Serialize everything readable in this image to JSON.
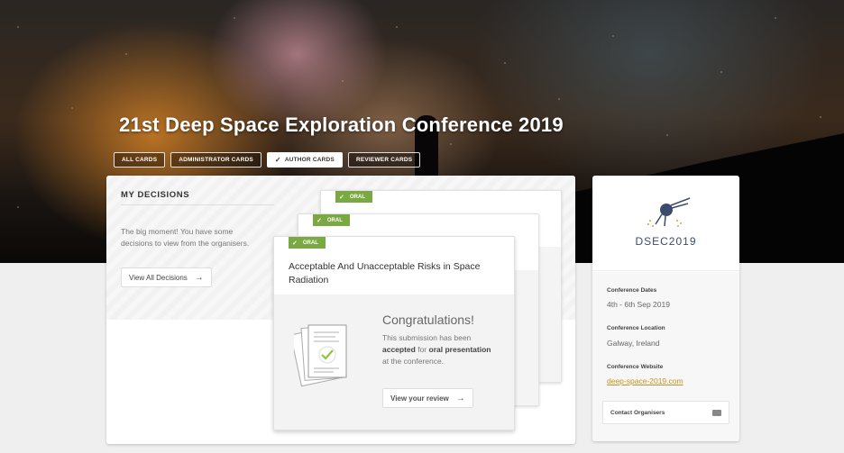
{
  "conference": {
    "title": "21st Deep Space Exploration Conference 2019"
  },
  "tabs": [
    {
      "label": "ALL CARDS",
      "active": false
    },
    {
      "label": "ADMINISTRATOR CARDS",
      "active": false
    },
    {
      "label": "AUTHOR CARDS",
      "active": true
    },
    {
      "label": "REVIEWER CARDS",
      "active": false
    }
  ],
  "decisions": {
    "heading": "MY DECISIONS",
    "intro": "The big moment! You have some decisions to view from the organisers.",
    "view_all_label": "View All Decisions",
    "cards": [
      {
        "badge": "ORAL",
        "title": "Acceptable And Unacceptable Risks in Space Radiation",
        "congrats_title": "Congratulations!",
        "message_pre": "This submission has been ",
        "message_accepted": "accepted",
        "message_for": " for ",
        "message_oral": "oral presentation",
        "message_post": " at the conference.",
        "review_label": "View your review"
      },
      {
        "badge": "ORAL"
      },
      {
        "badge": "ORAL"
      }
    ]
  },
  "sidebar": {
    "logo_text": "DSEC2019",
    "dates_label": "Conference Dates",
    "dates_value": "4th - 6th Sep 2019",
    "location_label": "Conference Location",
    "location_value": "Galway, Ireland",
    "website_label": "Conference Website",
    "website_value": "deep-space-2019.com",
    "contact_label": "Contact Organisers"
  },
  "colors": {
    "oral_badge": "#7aa843",
    "link": "#c8901e",
    "logo": "#3c4a6b",
    "check": "#8cc63f"
  },
  "icons": {
    "tab_active": "checkmark-icon",
    "button_arrow": "arrow-right-icon",
    "contact": "mail-icon",
    "logo": "comet-satellite-icon",
    "document": "document-check-icon"
  }
}
